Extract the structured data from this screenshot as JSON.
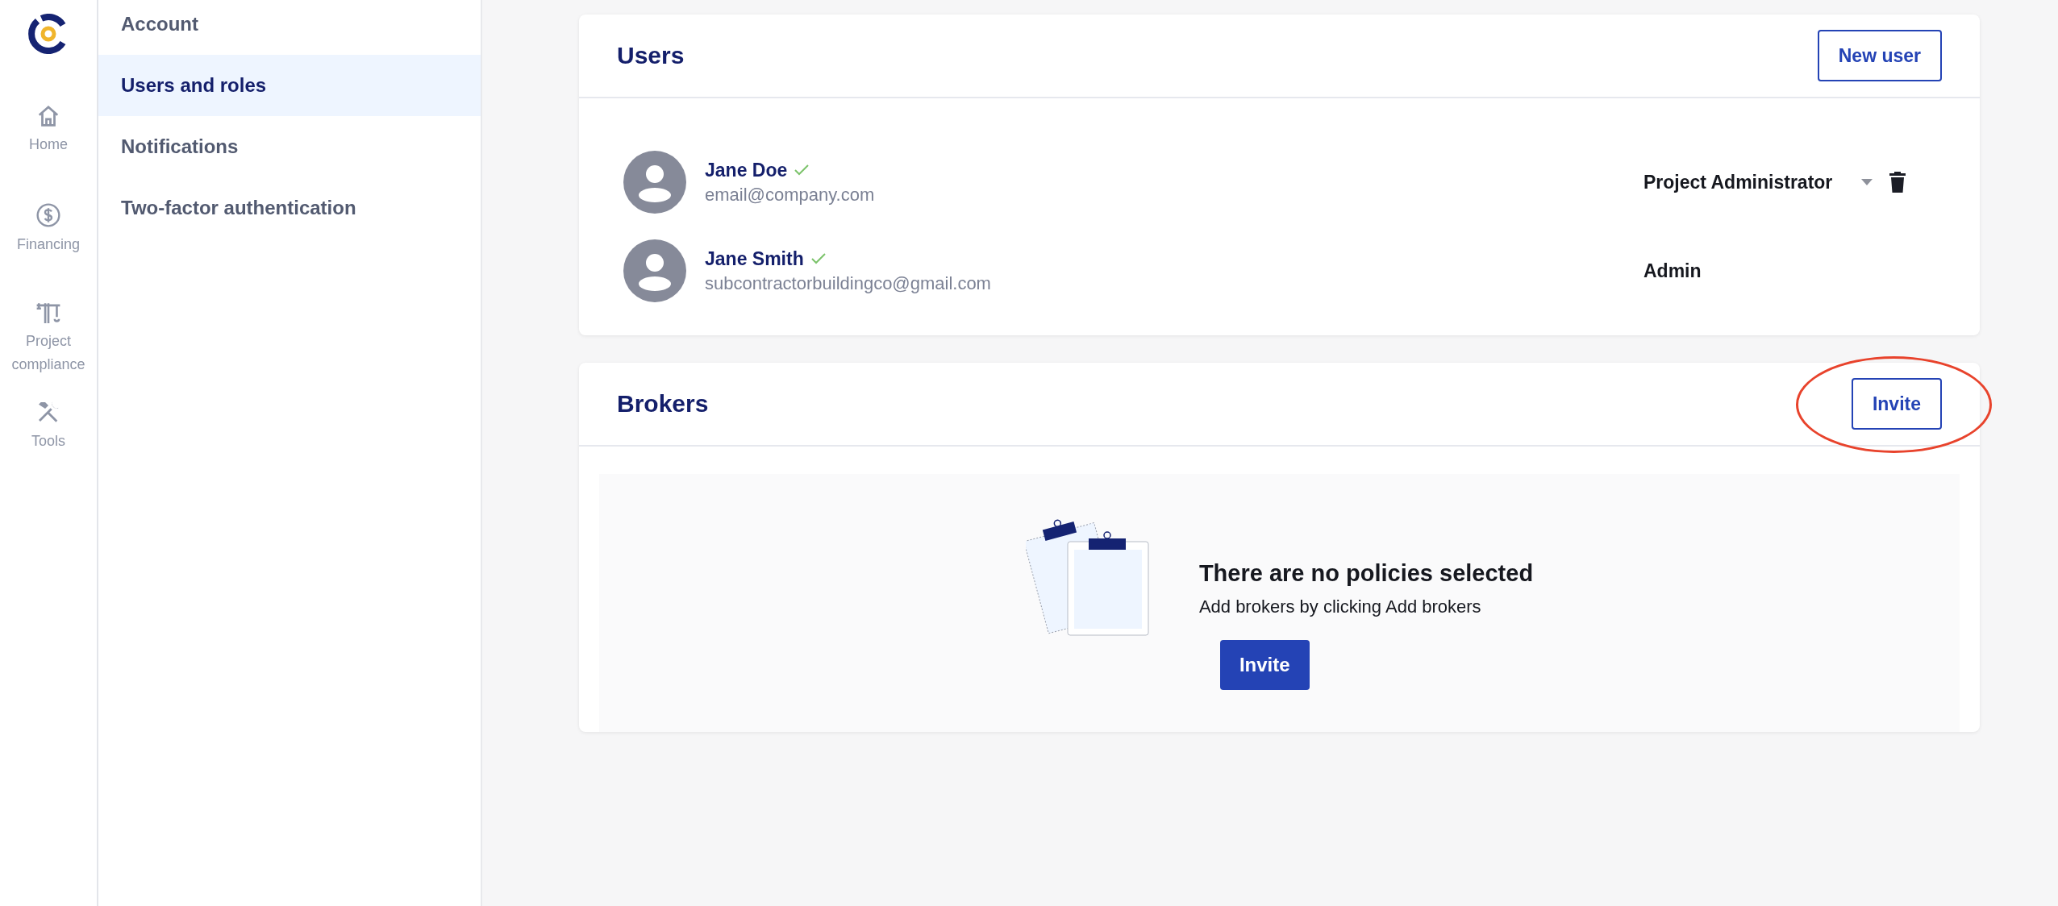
{
  "rail": {
    "items": [
      {
        "kind": "home",
        "label": "Home"
      },
      {
        "kind": "money",
        "label": "Financing"
      },
      {
        "kind": "crane",
        "label": "Project compliance"
      },
      {
        "kind": "tools",
        "label": "Tools"
      }
    ]
  },
  "settings_menu": {
    "items": [
      {
        "label": "Account",
        "selected": false
      },
      {
        "label": "Users and roles",
        "selected": true
      },
      {
        "label": "Notifications",
        "selected": false
      },
      {
        "label": "Two-factor authentication",
        "selected": false
      }
    ]
  },
  "users": {
    "title": "Users",
    "button": "New user",
    "rows": [
      {
        "name": "Jane Doe",
        "verified": true,
        "email": "email@company.com",
        "role": "Project Administrator",
        "editable": true
      },
      {
        "name": "Jane Smith",
        "verified": true,
        "email": "subcontractorbuildingco@gmail.com",
        "role": "Admin",
        "editable": false
      }
    ]
  },
  "brokers": {
    "title": "Brokers",
    "button": {
      "label": "Invite",
      "highlighted": true
    },
    "empty_state": {
      "heading": "There are no policies selected",
      "text": "Add brokers by clicking Add brokers",
      "button": "Invite"
    }
  }
}
